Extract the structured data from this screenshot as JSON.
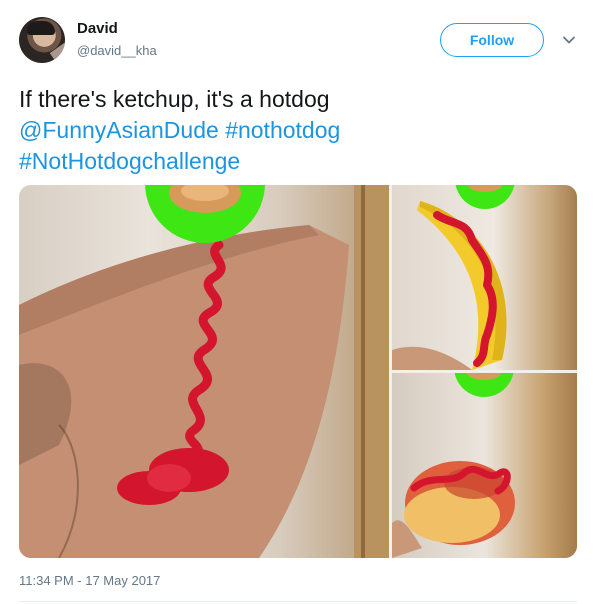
{
  "user": {
    "name": "David",
    "handle": "@david__kha"
  },
  "follow_button": {
    "label": "Follow"
  },
  "tweet": {
    "line1": "If there's ketchup, it's a hotdog",
    "mention": "@FunnyAsianDude",
    "hashtag1": "#nothotdog",
    "hashtag2": "#NotHotdogchallenge"
  },
  "timestamp": "11:34 PM - 17 May 2017",
  "colors": {
    "accent": "#1da1f2",
    "link": "#1b95e0",
    "ketchup": "#d4152e",
    "hotdog_badge": "#3ee614"
  },
  "icons": {
    "menu": "chevron-down-icon"
  }
}
